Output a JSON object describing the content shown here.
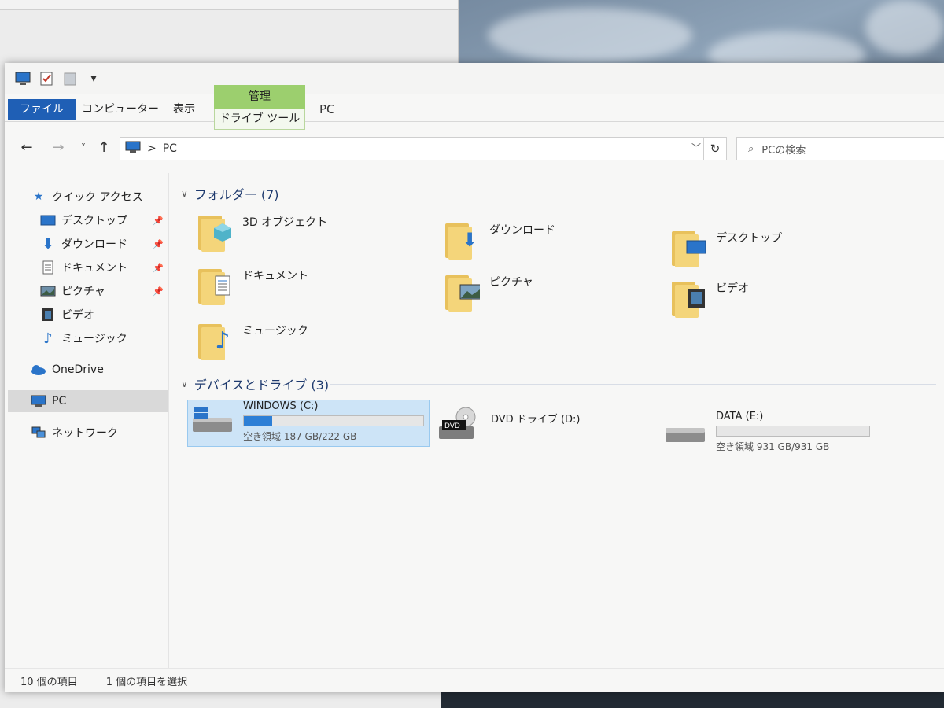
{
  "window": {
    "title": "PC"
  },
  "qat": {
    "icons": [
      "computer-icon",
      "properties-icon",
      "new-folder-icon",
      "customize-icon"
    ]
  },
  "ribbon": {
    "file_tab": "ファイル",
    "computer_tab": "コンピューター",
    "view_tab": "表示",
    "manage_label": "管理",
    "drive_tools_tab": "ドライブ ツール"
  },
  "address": {
    "path_separator": ">",
    "path": "PC",
    "search_placeholder": "PCの検索"
  },
  "sidebar": {
    "quick_access": "クイック アクセス",
    "items": [
      {
        "label": "デスクトップ",
        "icon": "desktop-icon",
        "pinned": true
      },
      {
        "label": "ダウンロード",
        "icon": "download-icon",
        "pinned": true
      },
      {
        "label": "ドキュメント",
        "icon": "document-icon",
        "pinned": true
      },
      {
        "label": "ピクチャ",
        "icon": "picture-icon",
        "pinned": true
      },
      {
        "label": "ビデオ",
        "icon": "video-icon",
        "pinned": false
      },
      {
        "label": "ミュージック",
        "icon": "music-icon",
        "pinned": false
      }
    ],
    "onedrive": "OneDrive",
    "pc": "PC",
    "network": "ネットワーク"
  },
  "folders": {
    "header": "フォルダー (7)",
    "items": [
      {
        "label": "3D オブジェクト",
        "icon": "3d-objects-icon"
      },
      {
        "label": "ダウンロード",
        "icon": "download-icon"
      },
      {
        "label": "デスクトップ",
        "icon": "desktop-icon"
      },
      {
        "label": "ドキュメント",
        "icon": "document-icon"
      },
      {
        "label": "ピクチャ",
        "icon": "picture-icon"
      },
      {
        "label": "ビデオ",
        "icon": "video-icon"
      },
      {
        "label": "ミュージック",
        "icon": "music-icon"
      }
    ]
  },
  "devices": {
    "header": "デバイスとドライブ (3)",
    "items": [
      {
        "name": "WINDOWS (C:)",
        "space": "空き領域 187 GB/222 GB",
        "used_fraction": 0.16,
        "icon": "windows-drive-icon",
        "selected": true
      },
      {
        "name": "DVD ドライブ (D:)",
        "space": "",
        "icon": "dvd-drive-icon",
        "selected": false,
        "badge": "DVD"
      },
      {
        "name": "DATA (E:)",
        "space": "空き領域 931 GB/931 GB",
        "used_fraction": 0.0,
        "icon": "hard-drive-icon",
        "selected": false
      }
    ]
  },
  "status": {
    "item_count": "10 個の項目",
    "selection": "1 個の項目を選択"
  },
  "colors": {
    "accent": "#1f5fb5",
    "manage_tab": "#9ccf6e",
    "selection": "#cde4f7",
    "progress": "#2d7fd6",
    "folder": "#f4d57a"
  }
}
